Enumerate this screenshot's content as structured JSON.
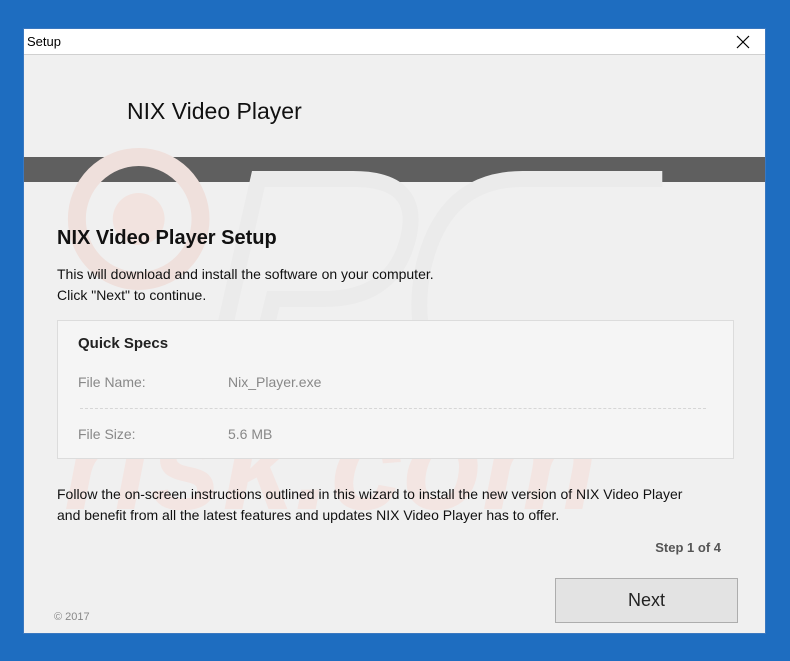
{
  "window": {
    "title": "Setup",
    "app_name": "NIX Video Player",
    "watermark_text": "PC risk.com"
  },
  "main": {
    "setup_title": "NIX Video Player Setup",
    "intro_line1": "This will download and install the software on your computer.",
    "intro_line2": "Click \"Next\" to continue.",
    "specs": {
      "title": "Quick Specs",
      "rows": [
        {
          "label": "File Name:",
          "value": "Nix_Player.exe"
        },
        {
          "label": "File Size:",
          "value": "5.6 MB"
        }
      ]
    },
    "footer_line1": "Follow the on-screen instructions outlined in this wizard to install the new version of NIX Video Player",
    "footer_line2": "and benefit from all the latest features and updates NIX Video Player has to offer.",
    "step": "Step 1 of 4",
    "next_label": "Next",
    "copyright": "© 2017"
  },
  "colors": {
    "desktop": "#1e6dc0",
    "window_bg": "#f0f0f0",
    "dark_bar": "#5f5f5f",
    "watermark": "#e8d0cc"
  },
  "icons": {
    "close": "close-icon"
  }
}
